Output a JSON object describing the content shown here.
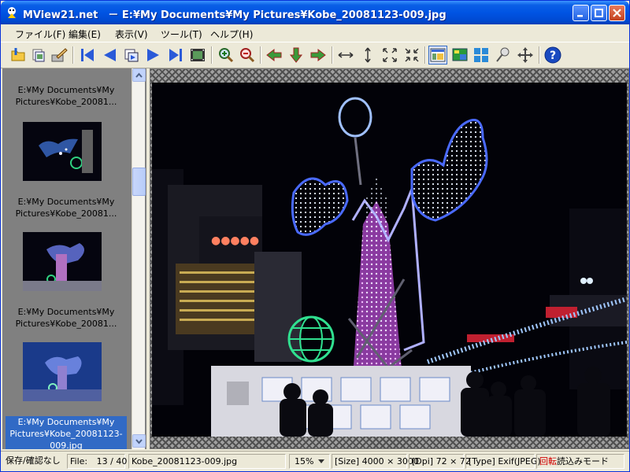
{
  "window": {
    "title": "MView21.net　－ E:¥My Documents¥My Pictures¥Kobe_20081123-009.jpg"
  },
  "menu": {
    "items": [
      "ファイル(F)",
      "編集(E)",
      "表示(V)",
      "ツール(T)",
      "ヘルプ(H)"
    ]
  },
  "toolbar": {
    "icons": [
      "open-folder-icon",
      "copy-icon",
      "edit-icon",
      "first-image-icon",
      "previous-image-icon",
      "slideshow-step-icon",
      "next-image-icon",
      "last-image-icon",
      "filmstrip-icon",
      "zoom-in-icon",
      "zoom-out-icon",
      "rotate-left-icon",
      "rotate-down-icon",
      "rotate-right-icon",
      "fit-width-icon",
      "fit-height-icon",
      "fit-window-icon",
      "actual-size-icon",
      "thumbnail-view-icon",
      "single-view-icon",
      "grid-view-icon",
      "pin-icon",
      "move-icon",
      "help-icon"
    ],
    "active": "thumbnail-view-icon"
  },
  "sidebar": {
    "thumbnails": [
      {
        "label": "E:¥My Documents¥My Pictures¥Kobe_20081..."
      },
      {
        "label": "E:¥My Documents¥My Pictures¥Kobe_20081..."
      },
      {
        "label": "E:¥My Documents¥My Pictures¥Kobe_20081..."
      },
      {
        "label": "E:¥My Documents¥My Pictures¥Kobe_20081123-009.jpg",
        "selected": true
      }
    ]
  },
  "status": {
    "save_state": "保存/確認なし",
    "file_label": "File:",
    "file_index": "13 / 40",
    "filename": "Kobe_20081123-009.jpg",
    "zoom": "15%",
    "size": "[Size] 4000 × 3000",
    "dpi": "[Dpi] 72 × 72",
    "type": "[Type] Exif(JPEG)",
    "rotate": "回転",
    "mode": "読込みモード"
  },
  "colors": {
    "titlebar": "#0054e3",
    "selection": "#316ac5",
    "accent_red": "#d00000"
  }
}
